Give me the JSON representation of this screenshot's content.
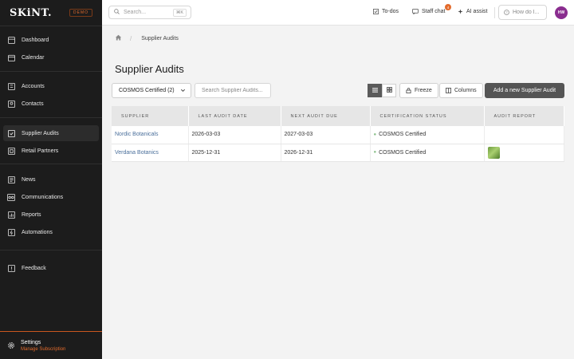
{
  "sidebar": {
    "logo": "SKiNT.",
    "badge": "DEMO",
    "items": [
      {
        "label": "Dashboard",
        "icon": "dashboard-icon"
      },
      {
        "label": "Calendar",
        "icon": "calendar-icon"
      },
      {
        "label": "Accounts",
        "icon": "accounts-icon"
      },
      {
        "label": "Contacts",
        "icon": "contacts-icon"
      },
      {
        "label": "Supplier Audits",
        "icon": "supplier-audits-icon",
        "active": true
      },
      {
        "label": "Retail Partners",
        "icon": "retail-partners-icon"
      },
      {
        "label": "News",
        "icon": "news-icon"
      },
      {
        "label": "Communications",
        "icon": "communications-icon"
      },
      {
        "label": "Reports",
        "icon": "reports-icon"
      },
      {
        "label": "Automations",
        "icon": "automations-icon"
      },
      {
        "label": "Feedback",
        "icon": "feedback-icon"
      }
    ],
    "settings": {
      "label": "Settings",
      "sublabel": "Manage Subscription"
    }
  },
  "topbar": {
    "search_placeholder": "Search...",
    "search_shortcut": "⌘K",
    "todos": "To-dos",
    "staff_chat": "Staff chat",
    "staff_chat_count": "4",
    "ai_assist": "AI assist",
    "how_do_i": "How do I...",
    "avatar_initials": "HW"
  },
  "breadcrumb": {
    "current": "Supplier Audits"
  },
  "page": {
    "title": "Supplier Audits"
  },
  "toolbar": {
    "filter_value": "COSMOS Certified (2)",
    "search_placeholder": "Search Supplier Audits...",
    "freeze": "Freeze",
    "columns": "Columns",
    "add": "Add a new Supplier Audit"
  },
  "table": {
    "headers": [
      "SUPPLIER",
      "LAST AUDIT DATE",
      "NEXT AUDIT DUE",
      "CERTIFICATION STATUS",
      "AUDIT REPORT"
    ],
    "rows": [
      {
        "supplier": "Nordic Botanicals",
        "last": "2026-03-03",
        "next": "2027-03-03",
        "status": "COSMOS Certified",
        "report": false
      },
      {
        "supplier": "Verdana Botanics",
        "last": "2025-12-31",
        "next": "2026-12-31",
        "status": "COSMOS Certified",
        "report": true
      }
    ]
  },
  "colors": {
    "accent": "#e36b2c",
    "sidebar_bg": "#1c1c1c",
    "link": "#4a6f9b",
    "status_dot": "#8cc08c"
  }
}
